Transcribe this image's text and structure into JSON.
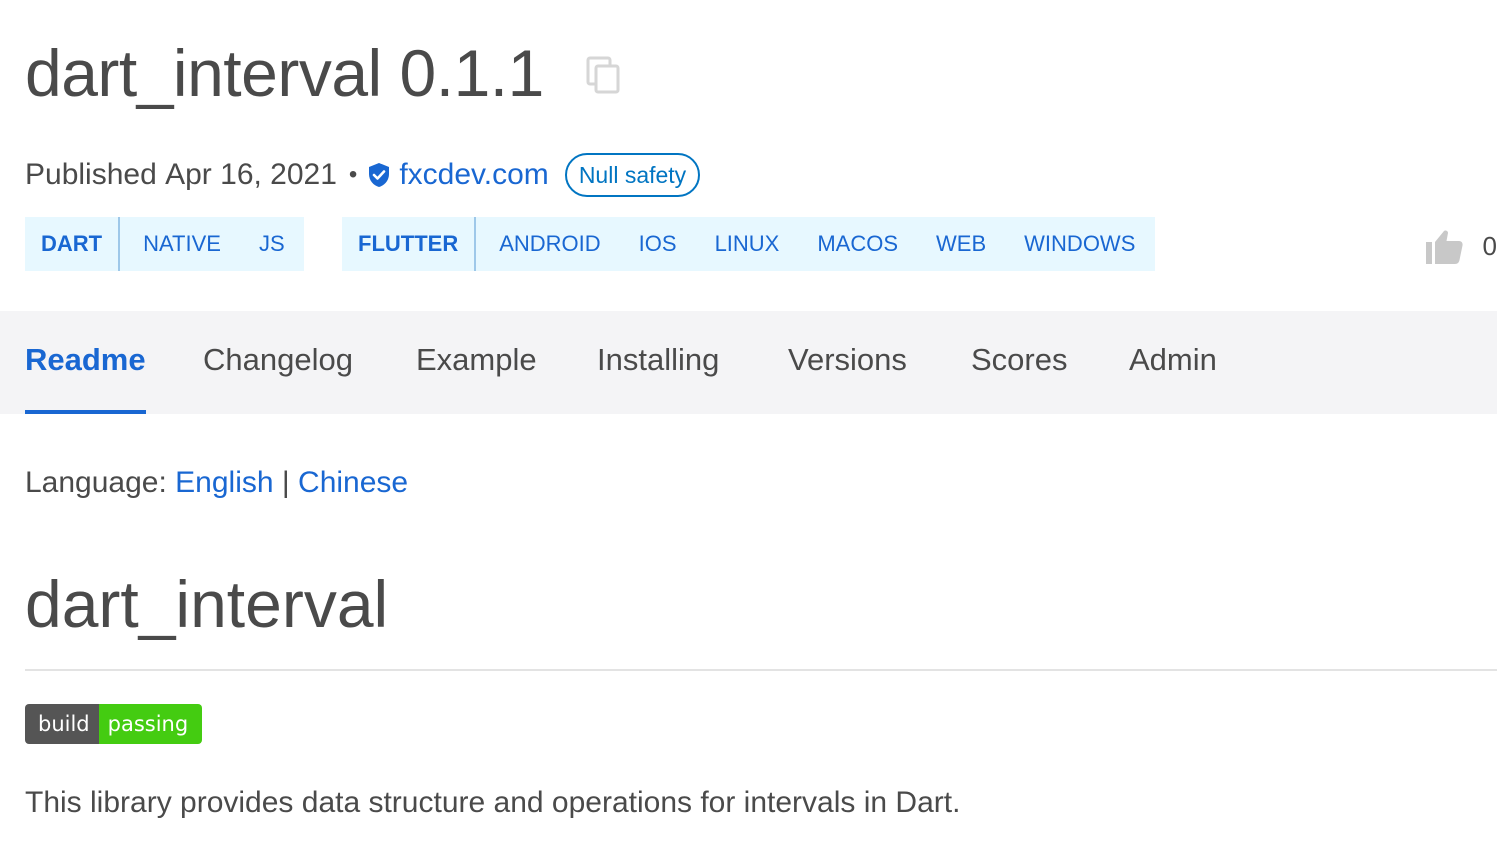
{
  "package": {
    "title": "dart_interval 0.1.1"
  },
  "meta": {
    "published_label": "Published",
    "published_date": "Apr 16, 2021",
    "separator": "•",
    "publisher": "fxcdev.com",
    "null_safety_badge": "Null safety"
  },
  "sdk_tags": [
    {
      "main": "DART",
      "platforms": [
        "NATIVE",
        "JS"
      ]
    },
    {
      "main": "FLUTTER",
      "platforms": [
        "ANDROID",
        "IOS",
        "LINUX",
        "MACOS",
        "WEB",
        "WINDOWS"
      ]
    }
  ],
  "likes": {
    "count": "0"
  },
  "tabs": [
    {
      "label": "Readme",
      "active": true
    },
    {
      "label": "Changelog",
      "active": false
    },
    {
      "label": "Example",
      "active": false
    },
    {
      "label": "Installing",
      "active": false
    },
    {
      "label": "Versions",
      "active": false
    },
    {
      "label": "Scores",
      "active": false
    },
    {
      "label": "Admin",
      "active": false
    }
  ],
  "readme": {
    "language_label": "Language:",
    "language_english": "English",
    "language_sep": "|",
    "language_chinese": "Chinese",
    "heading": "dart_interval",
    "badge_left": "build",
    "badge_right": "passing",
    "description": "This library provides data structure and operations for intervals in Dart."
  },
  "colors": {
    "link": "#1967d2",
    "tag_bg": "#e7f8ff",
    "tabbar_bg": "#f4f4f6",
    "badge_gray": "#555555",
    "badge_green": "#44cc11"
  },
  "icons": [
    "copy-icon",
    "verified-icon",
    "thumb-up-icon"
  ]
}
